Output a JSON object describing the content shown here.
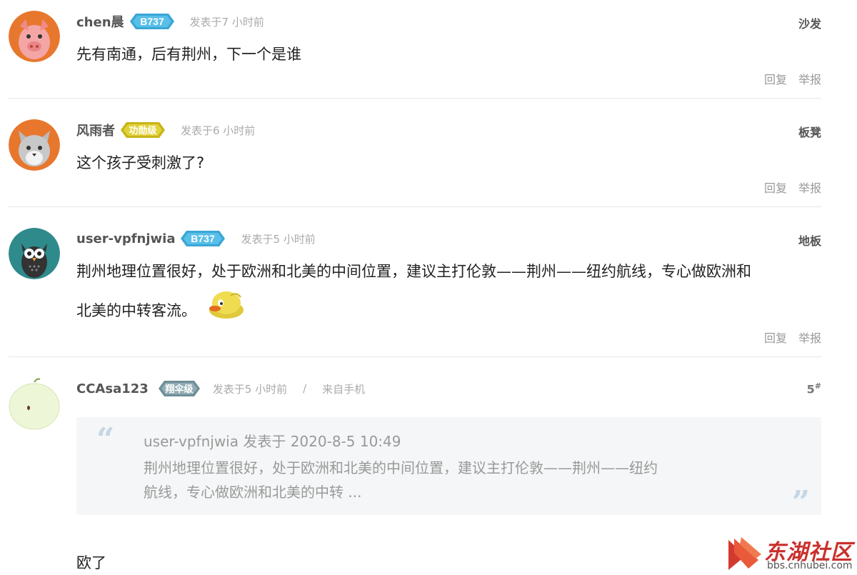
{
  "posts": [
    {
      "username": "chen晨",
      "badge": "B737",
      "time": "发表于7 小时前",
      "floor": "沙发",
      "content": "先有南通，后有荆州，下一个是谁",
      "actions": {
        "reply": "回复",
        "report": "举报"
      }
    },
    {
      "username": "风雨者",
      "badge": "功勋级",
      "time": "发表于6 小时前",
      "floor": "板凳",
      "content": "这个孩子受刺激了?",
      "actions": {
        "reply": "回复",
        "report": "举报"
      }
    },
    {
      "username": "user-vpfnjwia",
      "badge": "B737",
      "time": "发表于5 小时前",
      "floor": "地板",
      "content_line1": "荆州地理位置很好，处于欧洲和北美的中间位置，建议主打伦敦——荆州——纽约航线，专心做欧洲和",
      "content_line2": "北美的中转客流。",
      "actions": {
        "reply": "回复",
        "report": "举报"
      }
    },
    {
      "username": "CCAsa123",
      "badge": "翔伞级",
      "time": "发表于5 小时前",
      "separator": "/",
      "from": "来自手机",
      "floor": "5",
      "floor_mark": "#",
      "quote": {
        "header": "user-vpfnjwia 发表于 2020-8-5 10:49",
        "body_line1": "荆州地理位置很好，处于欧洲和北美的中间位置，建议主打伦敦——荆州——纽约",
        "body_line2": "航线，专心做欧洲和北美的中转 ..."
      },
      "content": "欧了"
    }
  ],
  "watermark": {
    "name": "东湖社区",
    "url": "bbs.cnhubei.com"
  },
  "colors": {
    "badge_b737": "#3aa6d6",
    "badge_gold": "#d4c21c",
    "badge_gray": "#7d9aa3",
    "logo_red": "#c9302c"
  }
}
